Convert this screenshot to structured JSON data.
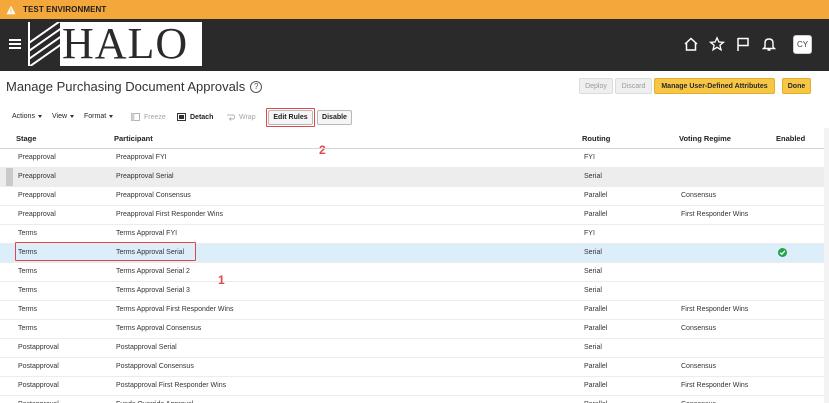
{
  "env_banner": {
    "text": "TEST ENVIRONMENT",
    "color": "#f4a83b"
  },
  "header": {
    "logo_text": "HALO",
    "icons": [
      "menu-icon",
      "home-icon",
      "star-icon",
      "flag-icon",
      "bell-icon"
    ],
    "user_initials": "CY"
  },
  "page": {
    "title": "Manage Purchasing Document Approvals",
    "help": "?",
    "buttons": {
      "deploy": "Deploy",
      "discard": "Discard",
      "manage_attrs": "Manage User-Defined Attributes",
      "done": "Done"
    }
  },
  "toolbar": {
    "actions": "Actions",
    "view": "View",
    "format": "Format",
    "freeze": "Freeze",
    "detach": "Detach",
    "wrap": "Wrap",
    "edit_rules": "Edit Rules",
    "disable": "Disable"
  },
  "annotations": {
    "marker_1": "1",
    "marker_2": "2",
    "color": "#e0464a"
  },
  "table": {
    "headers": {
      "stage": "Stage",
      "participant": "Participant",
      "routing": "Routing",
      "voting": "Voting Regime",
      "enabled": "Enabled"
    },
    "rows": [
      {
        "stage": "Preapproval",
        "participant": "Preapproval FYI",
        "routing": "FYI",
        "voting": "",
        "enabled": false
      },
      {
        "stage": "Preapproval",
        "participant": "Preapproval Serial",
        "routing": "Serial",
        "voting": "",
        "enabled": false
      },
      {
        "stage": "Preapproval",
        "participant": "Preapproval Consensus",
        "routing": "Parallel",
        "voting": "Consensus",
        "enabled": false
      },
      {
        "stage": "Preapproval",
        "participant": "Preapproval First Responder Wins",
        "routing": "Parallel",
        "voting": "First Responder Wins",
        "enabled": false
      },
      {
        "stage": "Terms",
        "participant": "Terms Approval FYI",
        "routing": "FYI",
        "voting": "",
        "enabled": false
      },
      {
        "stage": "Terms",
        "participant": "Terms Approval Serial",
        "routing": "Serial",
        "voting": "",
        "enabled": true
      },
      {
        "stage": "Terms",
        "participant": "Terms Approval Serial 2",
        "routing": "Serial",
        "voting": "",
        "enabled": false
      },
      {
        "stage": "Terms",
        "participant": "Terms Approval Serial 3",
        "routing": "Serial",
        "voting": "",
        "enabled": false
      },
      {
        "stage": "Terms",
        "participant": "Terms Approval First Responder Wins",
        "routing": "Parallel",
        "voting": "First Responder Wins",
        "enabled": false
      },
      {
        "stage": "Terms",
        "participant": "Terms Approval Consensus",
        "routing": "Parallel",
        "voting": "Consensus",
        "enabled": false
      },
      {
        "stage": "Postapproval",
        "participant": "Postapproval Serial",
        "routing": "Serial",
        "voting": "",
        "enabled": false
      },
      {
        "stage": "Postapproval",
        "participant": "Postapproval Consensus",
        "routing": "Parallel",
        "voting": "Consensus",
        "enabled": false
      },
      {
        "stage": "Postapproval",
        "participant": "Postapproval First Responder Wins",
        "routing": "Parallel",
        "voting": "First Responder Wins",
        "enabled": false
      },
      {
        "stage": "Postapproval",
        "participant": "Funds Override Approval",
        "routing": "Parallel",
        "voting": "Consensus",
        "enabled": false
      }
    ]
  }
}
